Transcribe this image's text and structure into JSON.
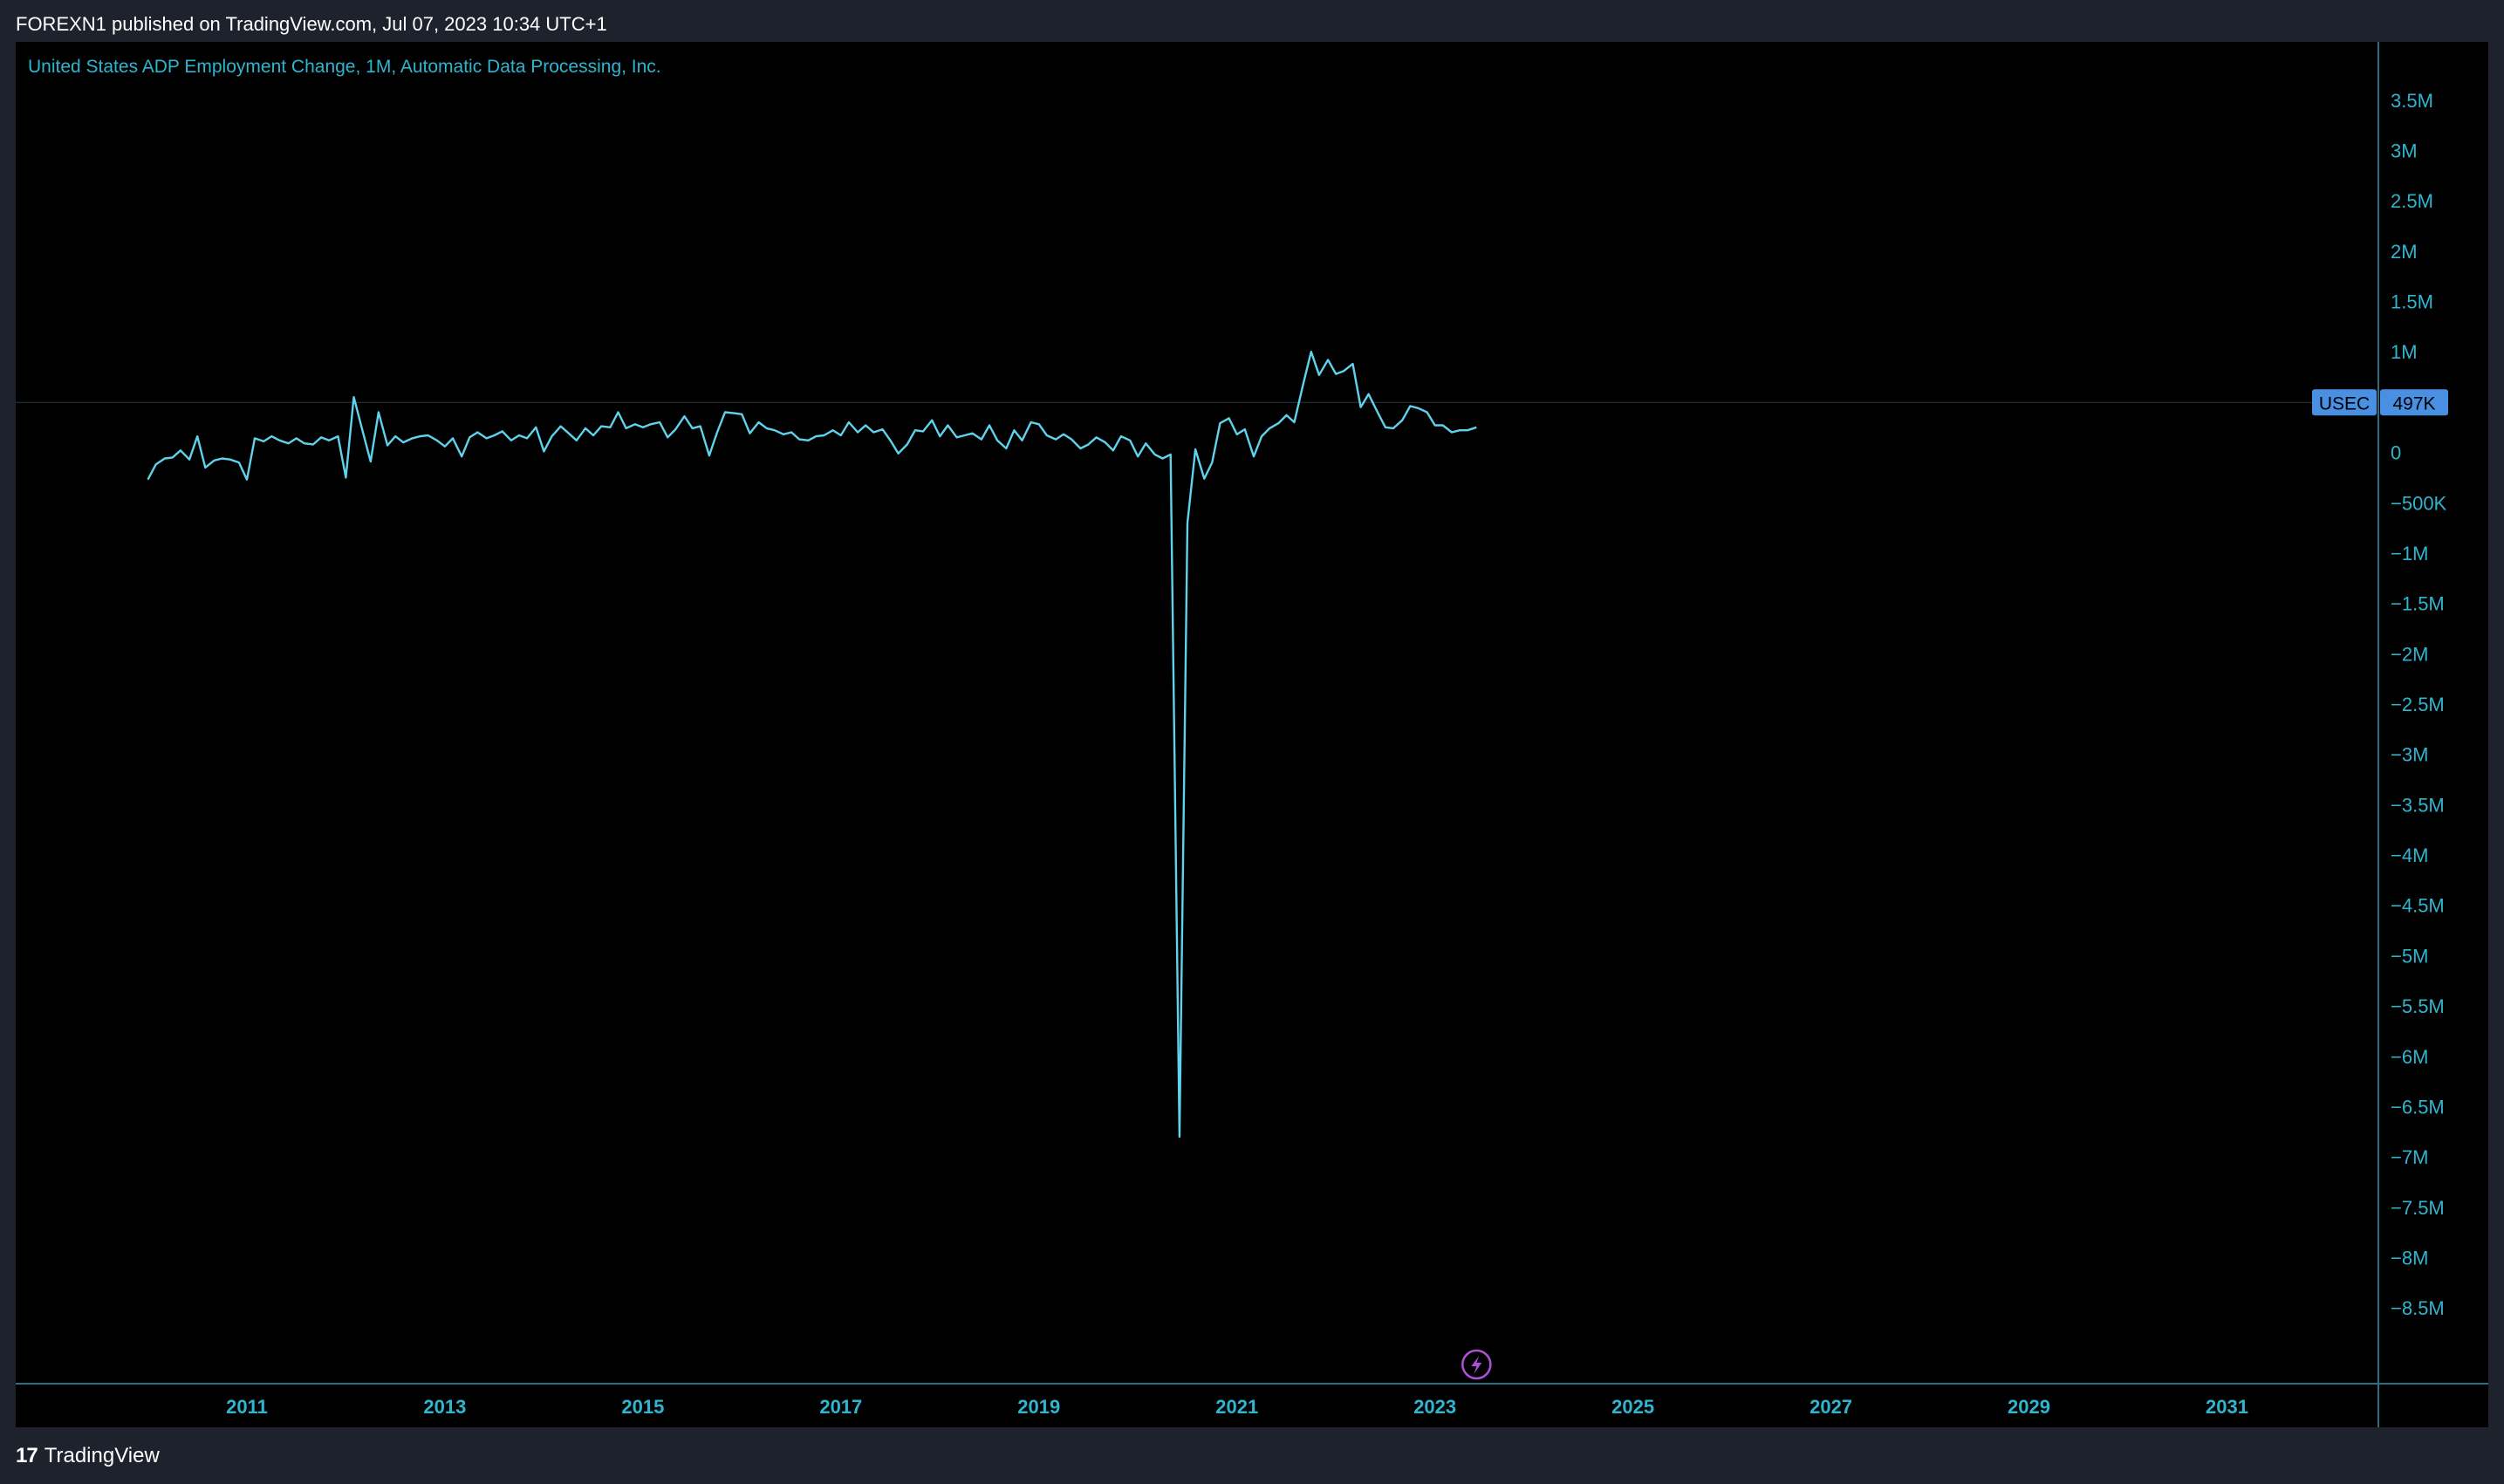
{
  "header": {
    "published": "FOREXN1 published on TradingView.com, Jul 07, 2023 10:34 UTC+1"
  },
  "footer": {
    "brand": "TradingView",
    "logo_text": "17"
  },
  "colors": {
    "line": "#5fd2ec",
    "axis_text": "#2fb5cf",
    "badge_bg": "#4a90e2",
    "panel_bg": "#000000",
    "frame_bg": "#1e222d",
    "lightning": "#b14fd6"
  },
  "chart_data": {
    "type": "line",
    "title": "United States ADP Employment Change, 1M, Automatic Data Processing, Inc.",
    "symbol": "USEC",
    "last_value_label": "497K",
    "last_value": 497000,
    "xlim": [
      2009.0,
      2032.3
    ],
    "ylim": [
      -8750000,
      3750000
    ],
    "y_ticks": [
      {
        "v": 3500000,
        "label": "3.5M"
      },
      {
        "v": 3000000,
        "label": "3M"
      },
      {
        "v": 2500000,
        "label": "2.5M"
      },
      {
        "v": 2000000,
        "label": "2M"
      },
      {
        "v": 1500000,
        "label": "1.5M"
      },
      {
        "v": 1000000,
        "label": "1M"
      },
      {
        "v": 0,
        "label": "0"
      },
      {
        "v": -500000,
        "label": "−500K"
      },
      {
        "v": -1000000,
        "label": "−1M"
      },
      {
        "v": -1500000,
        "label": "−1.5M"
      },
      {
        "v": -2000000,
        "label": "−2M"
      },
      {
        "v": -2500000,
        "label": "−2.5M"
      },
      {
        "v": -3000000,
        "label": "−3M"
      },
      {
        "v": -3500000,
        "label": "−3.5M"
      },
      {
        "v": -4000000,
        "label": "−4M"
      },
      {
        "v": -4500000,
        "label": "−4.5M"
      },
      {
        "v": -5000000,
        "label": "−5M"
      },
      {
        "v": -5500000,
        "label": "−5.5M"
      },
      {
        "v": -6000000,
        "label": "−6M"
      },
      {
        "v": -6500000,
        "label": "−6.5M"
      },
      {
        "v": -7000000,
        "label": "−7M"
      },
      {
        "v": -7500000,
        "label": "−7.5M"
      },
      {
        "v": -8000000,
        "label": "−8M"
      },
      {
        "v": -8500000,
        "label": "−8.5M"
      }
    ],
    "x_ticks": [
      {
        "v": 2011,
        "label": "2011"
      },
      {
        "v": 2013,
        "label": "2013"
      },
      {
        "v": 2015,
        "label": "2015"
      },
      {
        "v": 2017,
        "label": "2017"
      },
      {
        "v": 2019,
        "label": "2019"
      },
      {
        "v": 2021,
        "label": "2021"
      },
      {
        "v": 2023,
        "label": "2023"
      },
      {
        "v": 2025,
        "label": "2025"
      },
      {
        "v": 2027,
        "label": "2027"
      },
      {
        "v": 2029,
        "label": "2029"
      },
      {
        "v": 2031,
        "label": "2031"
      }
    ],
    "x": [
      2010.0,
      2010.08,
      2010.17,
      2010.25,
      2010.33,
      2010.42,
      2010.5,
      2010.58,
      2010.67,
      2010.75,
      2010.83,
      2010.92,
      2011.0,
      2011.08,
      2011.17,
      2011.25,
      2011.33,
      2011.42,
      2011.5,
      2011.58,
      2011.67,
      2011.75,
      2011.83,
      2011.92,
      2012.0,
      2012.08,
      2012.17,
      2012.25,
      2012.33,
      2012.42,
      2012.5,
      2012.58,
      2012.67,
      2012.75,
      2012.83,
      2012.92,
      2013.0,
      2013.08,
      2013.17,
      2013.25,
      2013.33,
      2013.42,
      2013.5,
      2013.58,
      2013.67,
      2013.75,
      2013.83,
      2013.92,
      2014.0,
      2014.08,
      2014.17,
      2014.25,
      2014.33,
      2014.42,
      2014.5,
      2014.58,
      2014.67,
      2014.75,
      2014.83,
      2014.92,
      2015.0,
      2015.08,
      2015.17,
      2015.25,
      2015.33,
      2015.42,
      2015.5,
      2015.58,
      2015.67,
      2015.75,
      2015.83,
      2015.92,
      2016.0,
      2016.08,
      2016.17,
      2016.25,
      2016.33,
      2016.42,
      2016.5,
      2016.58,
      2016.67,
      2016.75,
      2016.83,
      2016.92,
      2017.0,
      2017.08,
      2017.17,
      2017.25,
      2017.33,
      2017.42,
      2017.5,
      2017.58,
      2017.67,
      2017.75,
      2017.83,
      2017.92,
      2018.0,
      2018.08,
      2018.17,
      2018.25,
      2018.33,
      2018.42,
      2018.5,
      2018.58,
      2018.67,
      2018.75,
      2018.83,
      2018.92,
      2019.0,
      2019.08,
      2019.17,
      2019.25,
      2019.33,
      2019.42,
      2019.5,
      2019.58,
      2019.67,
      2019.75,
      2019.83,
      2019.92,
      2020.0,
      2020.08,
      2020.17,
      2020.25,
      2020.33,
      2020.42,
      2020.5,
      2020.58,
      2020.67,
      2020.75,
      2020.83,
      2020.92,
      2021.0,
      2021.08,
      2021.17,
      2021.25,
      2021.33,
      2021.42,
      2021.5,
      2021.58,
      2021.67,
      2021.75,
      2021.83,
      2021.92,
      2022.0,
      2022.08,
      2022.17,
      2022.25,
      2022.33,
      2022.42,
      2022.5,
      2022.58,
      2022.67,
      2022.75,
      2022.83,
      2022.92,
      2023.0,
      2023.08,
      2023.17,
      2023.25,
      2023.33,
      2023.42
    ],
    "values": [
      -270000,
      -120000,
      -60000,
      -50000,
      20000,
      -70000,
      160000,
      -150000,
      -80000,
      -60000,
      -70000,
      -100000,
      -270000,
      140000,
      110000,
      160000,
      120000,
      90000,
      140000,
      90000,
      80000,
      150000,
      120000,
      160000,
      -250000,
      550000,
      210000,
      -90000,
      400000,
      70000,
      160000,
      100000,
      140000,
      160000,
      170000,
      120000,
      60000,
      140000,
      -40000,
      150000,
      200000,
      140000,
      170000,
      210000,
      120000,
      170000,
      140000,
      250000,
      10000,
      160000,
      260000,
      190000,
      120000,
      240000,
      170000,
      260000,
      250000,
      400000,
      240000,
      280000,
      250000,
      280000,
      300000,
      150000,
      230000,
      360000,
      240000,
      260000,
      -30000,
      200000,
      400000,
      390000,
      380000,
      190000,
      300000,
      240000,
      220000,
      180000,
      200000,
      130000,
      120000,
      160000,
      170000,
      220000,
      170000,
      300000,
      200000,
      270000,
      200000,
      230000,
      120000,
      -10000,
      80000,
      220000,
      210000,
      320000,
      160000,
      270000,
      150000,
      170000,
      190000,
      130000,
      270000,
      120000,
      40000,
      220000,
      120000,
      300000,
      280000,
      170000,
      130000,
      180000,
      130000,
      40000,
      80000,
      150000,
      100000,
      20000,
      160000,
      120000,
      -40000,
      90000,
      -20000,
      -60000,
      -20000,
      -6800000,
      -700000,
      30000,
      -260000,
      -100000,
      290000,
      340000,
      180000,
      230000,
      -40000,
      160000,
      240000,
      290000,
      370000,
      300000,
      680000,
      1000000,
      770000,
      920000,
      780000,
      810000,
      880000,
      450000,
      580000,
      400000,
      250000,
      240000,
      320000,
      460000,
      440000,
      400000,
      270000,
      270000,
      200000,
      220000,
      220000,
      250000,
      160000,
      290000,
      130000,
      200000,
      300000,
      290000,
      500000,
      497000
    ]
  }
}
